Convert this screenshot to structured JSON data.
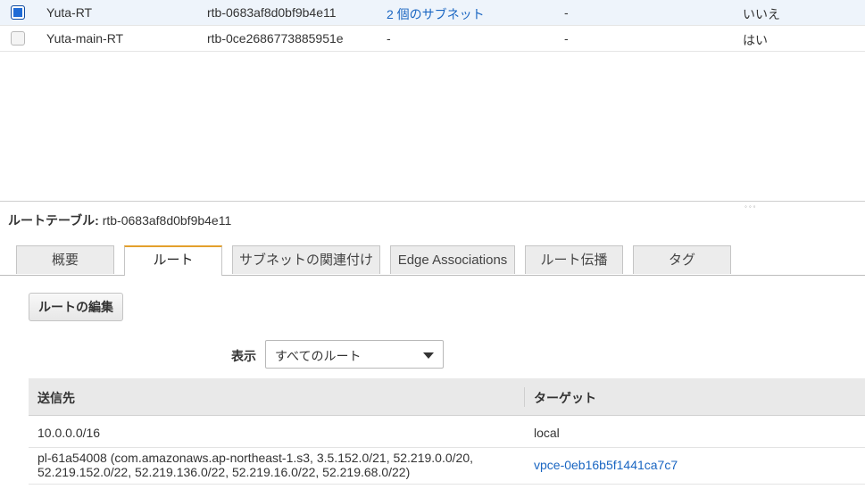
{
  "route_tables": [
    {
      "name": "Yuta-RT",
      "id": "rtb-0683af8d0bf9b4e11",
      "subnets": "2 個のサブネット",
      "edge": "-",
      "main": "いいえ",
      "selected": true
    },
    {
      "name": "Yuta-main-RT",
      "id": "rtb-0ce2686773885951e",
      "subnets": "-",
      "edge": "-",
      "main": "はい",
      "selected": false
    }
  ],
  "detail": {
    "label": "ルートテーブル:",
    "id": "rtb-0683af8d0bf9b4e11"
  },
  "tabs": [
    "概要",
    "ルート",
    "サブネットの関連付け",
    "Edge Associations",
    "ルート伝播",
    "タグ"
  ],
  "active_tab": "ルート",
  "edit_button": "ルートの編集",
  "filter": {
    "label": "表示",
    "value": "すべてのルート"
  },
  "routes_header": {
    "destination": "送信先",
    "target": "ターゲット"
  },
  "routes": [
    {
      "destination_line1": "10.0.0.0/16",
      "destination_line2": "",
      "target": "local",
      "target_is_link": false
    },
    {
      "destination_line1": "pl-61a54008 (com.amazonaws.ap-northeast-1.s3, 3.5.152.0/21, 52.219.0.0/20,",
      "destination_line2": "52.219.152.0/22, 52.219.136.0/22, 52.219.16.0/22, 52.219.68.0/22)",
      "target": "vpce-0eb16b5f1441ca7c7",
      "target_is_link": true
    }
  ],
  "colors": {
    "accent_tab": "#e4a02c",
    "link": "#1a66c2",
    "checkbox_checked": "#1f6bd6"
  }
}
